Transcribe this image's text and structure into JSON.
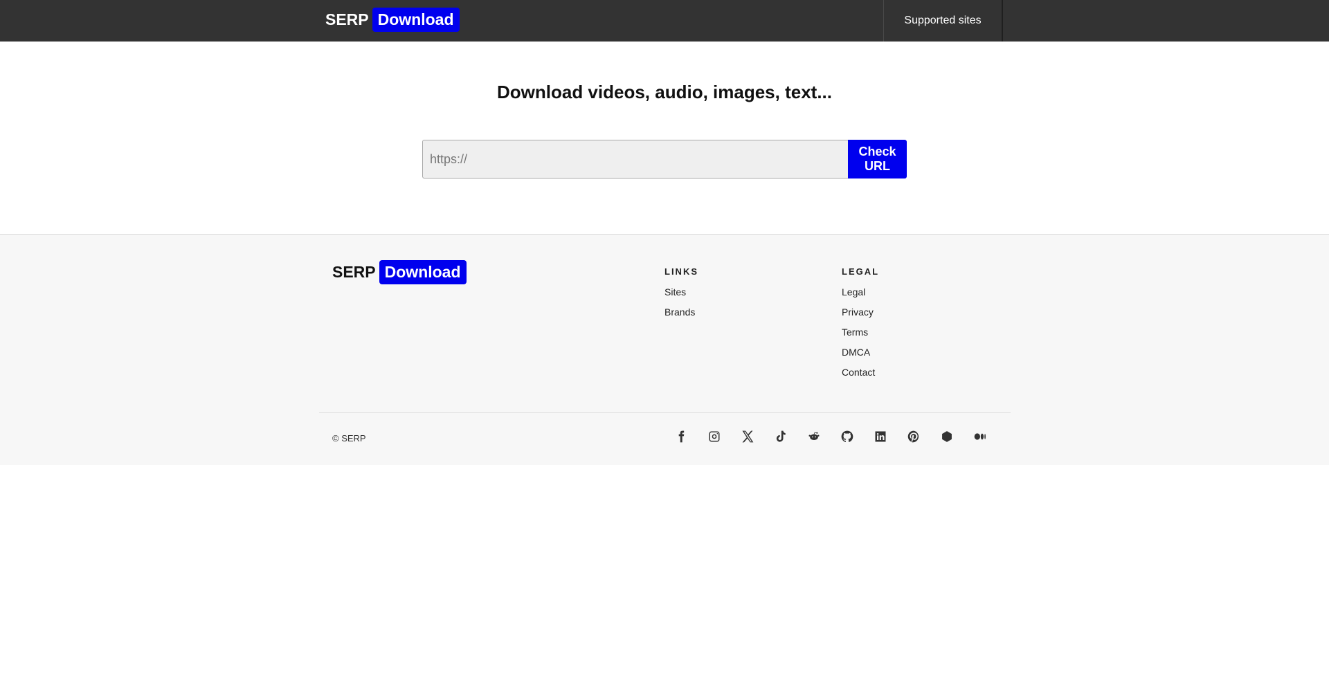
{
  "nav": {
    "brand_text": "SERP",
    "brand_badge": "Download",
    "supported_sites": "Supported sites"
  },
  "hero": {
    "title": "Download videos, audio, images, text...",
    "url_placeholder": "https://",
    "check_button": "Check\nURL"
  },
  "footer": {
    "brand_text": "SERP",
    "brand_badge": "Download",
    "links_title": "LINKS",
    "links": [
      "Sites",
      "Brands"
    ],
    "legal_title": "LEGAL",
    "legal": [
      "Legal",
      "Privacy",
      "Terms",
      "DMCA",
      "Contact"
    ],
    "copyright": "© SERP",
    "social_icons": [
      "facebook-icon",
      "instagram-icon",
      "x-icon",
      "tiktok-icon",
      "reddit-icon",
      "github-icon",
      "linkedin-icon",
      "pinterest-icon",
      "hexagon-icon",
      "medium-icon"
    ]
  },
  "colors": {
    "navbar": "#333333",
    "accent": "#0000ee",
    "footer_bg": "#f7f7f7"
  }
}
